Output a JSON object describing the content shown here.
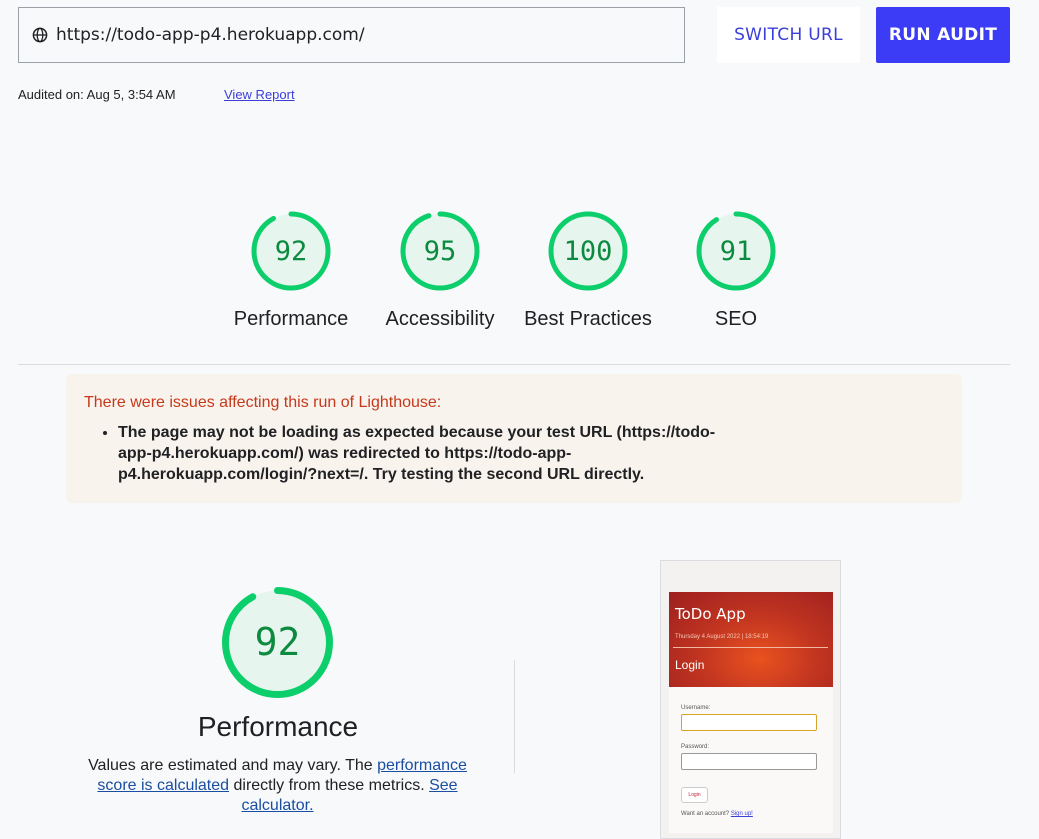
{
  "toolbar": {
    "url_value": "https://todo-app-p4.herokuapp.com/",
    "switch_label": "SWITCH URL",
    "run_label": "RUN AUDIT"
  },
  "audit": {
    "audited_on": "Audited on: Aug 5, 3:54 AM",
    "view_report": "View Report"
  },
  "scores": [
    {
      "label": "Performance",
      "value": "92",
      "fraction": 0.92
    },
    {
      "label": "Accessibility",
      "value": "95",
      "fraction": 0.95
    },
    {
      "label": "Best Practices",
      "value": "100",
      "fraction": 1.0
    },
    {
      "label": "SEO",
      "value": "91",
      "fraction": 0.91
    }
  ],
  "warning": {
    "title": "There were issues affecting this run of Lighthouse:",
    "items": [
      "The page may not be loading as expected because your test URL (https://todo-app-p4.herokuapp.com/) was redirected to https://todo-app-p4.herokuapp.com/login/?next=/. Try testing the second URL directly."
    ]
  },
  "performance": {
    "value": "92",
    "fraction": 0.92,
    "title": "Performance",
    "desc_1": "Values are estimated and may vary. The ",
    "desc_link_1": "performance score is calculated",
    "desc_2": " directly from these metrics. ",
    "desc_link_2": "See calculator."
  },
  "screenshot": {
    "app_title": "ToDo App",
    "date": "Thursday 4 August 2022 | 18:54:19",
    "heading": "Login",
    "username_label": "Username:",
    "password_label": "Password:",
    "login_button": "Login",
    "footer_text": "Want an account? ",
    "signup_link": "Sign up!"
  },
  "colors": {
    "pass_green": "#0cce6b",
    "pass_fill": "#e6f6ee",
    "accent": "#3c3cf7",
    "warning_text": "#c5391b"
  }
}
